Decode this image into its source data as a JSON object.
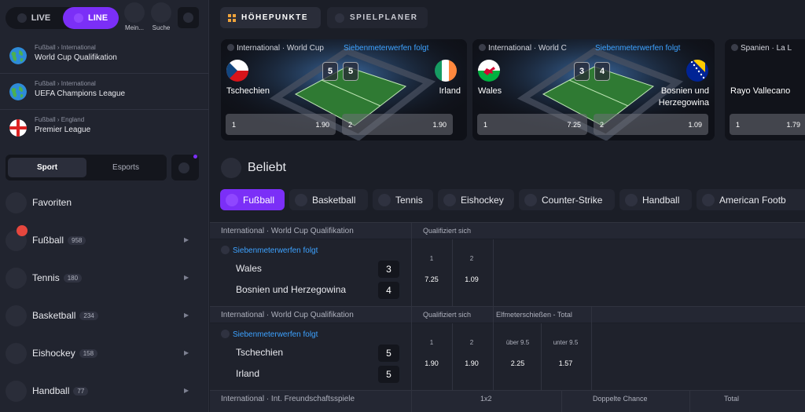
{
  "sidebar": {
    "toggle": {
      "live": "LIVE",
      "line": "LINE"
    },
    "top_icons": [
      {
        "label": "Mein..."
      },
      {
        "label": "Suche"
      }
    ],
    "leagues": [
      {
        "crumb": [
          "Fußball",
          "International"
        ],
        "name": "World Cup Qualifikation",
        "flag": "globe-icon"
      },
      {
        "crumb": [
          "Fußball",
          "International"
        ],
        "name": "UEFA Champions League",
        "flag": "globe-icon"
      },
      {
        "crumb": [
          "Fußball",
          "England"
        ],
        "name": "Premier League",
        "flag": "england-flag-icon"
      }
    ],
    "tabs": {
      "sport": "Sport",
      "esports": "Esports"
    },
    "sports": [
      {
        "label": "Favoriten",
        "count": ""
      },
      {
        "label": "Fußball",
        "count": "958"
      },
      {
        "label": "Tennis",
        "count": "180"
      },
      {
        "label": "Basketball",
        "count": "234"
      },
      {
        "label": "Eishockey",
        "count": "158"
      },
      {
        "label": "Handball",
        "count": "77"
      }
    ]
  },
  "header": {
    "highlights": "HÖHEPUNKTE",
    "schedule": "SPIELPLANER"
  },
  "cards": [
    {
      "hdr": "International · World Cup",
      "status": "Siebenmeterwerfen folgt",
      "home": "Tschechien",
      "away": "Irland",
      "score_home": "5",
      "score_away": "5",
      "odd1_key": "1",
      "odd1_val": "1.90",
      "odd2_key": "2",
      "odd2_val": "1.90"
    },
    {
      "hdr": "International · World C",
      "status": "Siebenmeterwerfen folgt",
      "home": "Wales",
      "away_line1": "Bosnien und",
      "away_line2": "Herzegowina",
      "score_home": "3",
      "score_away": "4",
      "odd1_key": "1",
      "odd1_val": "7.25",
      "odd2_key": "2",
      "odd2_val": "1.09"
    },
    {
      "hdr": "Spanien · La L",
      "home": "Rayo Vallecano",
      "odd1_key": "1",
      "odd1_val": "1.79"
    }
  ],
  "beliebt": "Beliebt",
  "chips": [
    "Fußball",
    "Basketball",
    "Tennis",
    "Eishockey",
    "Counter-Strike",
    "Handball",
    "American Footb"
  ],
  "events": [
    {
      "crumb": "International · World Cup Qualifikation",
      "headers": [
        "Qualifiziert sich"
      ],
      "status": "Siebenmeterwerfen folgt",
      "team1": "Wales",
      "score1": "3",
      "team2": "Bosnien und Herzegowina",
      "score2": "4",
      "odds": [
        {
          "k": "1",
          "v": "7.25"
        },
        {
          "k": "2",
          "v": "1.09"
        }
      ]
    },
    {
      "crumb": "International · World Cup Qualifikation",
      "headers": [
        "Qualifiziert sich",
        "Elfmeterschießen - Total"
      ],
      "status": "Siebenmeterwerfen folgt",
      "team1": "Tschechien",
      "score1": "5",
      "team2": "Irland",
      "score2": "5",
      "odds": [
        {
          "k": "1",
          "v": "1.90"
        },
        {
          "k": "2",
          "v": "1.90"
        },
        {
          "k": "über 9.5",
          "v": "2.25"
        },
        {
          "k": "unter 9.5",
          "v": "1.57"
        }
      ]
    },
    {
      "crumb": "International · Int. Freundschaftsspiele",
      "headers": [
        "1x2",
        "Doppelte Chance",
        "Total"
      ]
    }
  ],
  "colors": {
    "accent": "#7b2ff7",
    "live_status": "#3da2ff",
    "badge_red": "#e5473e"
  }
}
